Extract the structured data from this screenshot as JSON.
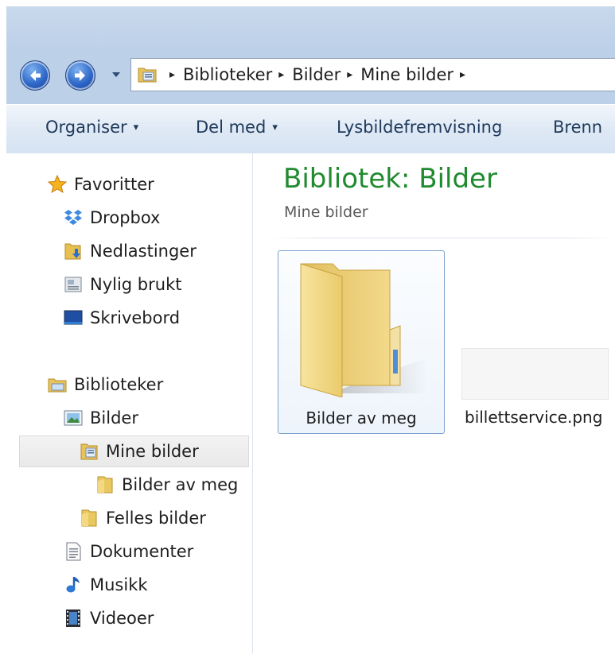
{
  "address_bar": {
    "crumbs": [
      "Biblioteker",
      "Bilder",
      "Mine bilder"
    ],
    "separator": "▸"
  },
  "toolbar": {
    "organise": "Organiser",
    "share": "Del med",
    "slideshow": "Lysbildefremvisning",
    "burn": "Brenn",
    "caret": "▾"
  },
  "nav": {
    "favorites_header": "Favoritter",
    "favorites": [
      "Dropbox",
      "Nedlastinger",
      "Nylig brukt",
      "Skrivebord"
    ],
    "libraries_header": "Biblioteker",
    "pictures": "Bilder",
    "my_pictures": "Mine bilder",
    "pictures_of_me": "Bilder av meg",
    "public_pictures": "Felles bilder",
    "documents": "Dokumenter",
    "music": "Musikk",
    "videos": "Videoer"
  },
  "content": {
    "title": "Bibliotek: Bilder",
    "subtitle": "Mine bilder",
    "items": [
      {
        "name": "Bilder av meg",
        "type": "folder"
      },
      {
        "name": "billettservice.png",
        "type": "png"
      }
    ]
  },
  "colors": {
    "title_green": "#1f8a2e",
    "selection_border": "#7da2ce",
    "toolbar_text": "#1e395b"
  },
  "icons": [
    "back-icon",
    "forward-icon",
    "library-folder-icon",
    "star-icon",
    "dropbox-icon",
    "downloads-icon",
    "recent-places-icon",
    "desktop-icon",
    "libraries-icon",
    "pictures-icon",
    "folder-icon",
    "documents-icon",
    "music-icon",
    "videos-icon"
  ]
}
